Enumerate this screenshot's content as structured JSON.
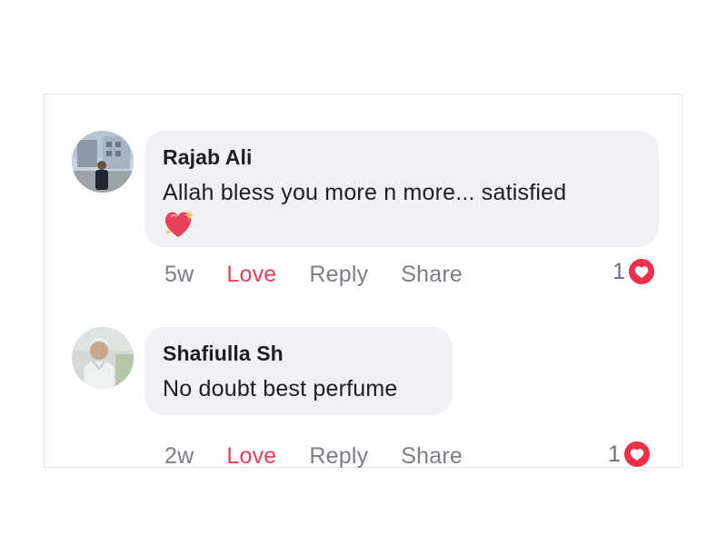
{
  "comments": [
    {
      "author": "Rajab Ali",
      "text": "Allah bless you more n more... satisfied",
      "emoji": "sparkling-heart",
      "time": "5w",
      "actions": {
        "love": "Love",
        "reply": "Reply",
        "share": "Share"
      },
      "reaction_count": "1",
      "reaction_type": "love"
    },
    {
      "author": "Shafiulla Sh",
      "text": "No doubt best perfume",
      "time": "2w",
      "actions": {
        "love": "Love",
        "reply": "Reply",
        "share": "Share"
      },
      "reaction_count": "1",
      "reaction_type": "love"
    }
  ],
  "colors": {
    "bubble": "#eff1f4",
    "love_accent": "#e4415a",
    "reaction_heart": "#f0304a",
    "muted_text": "#7b8087"
  }
}
